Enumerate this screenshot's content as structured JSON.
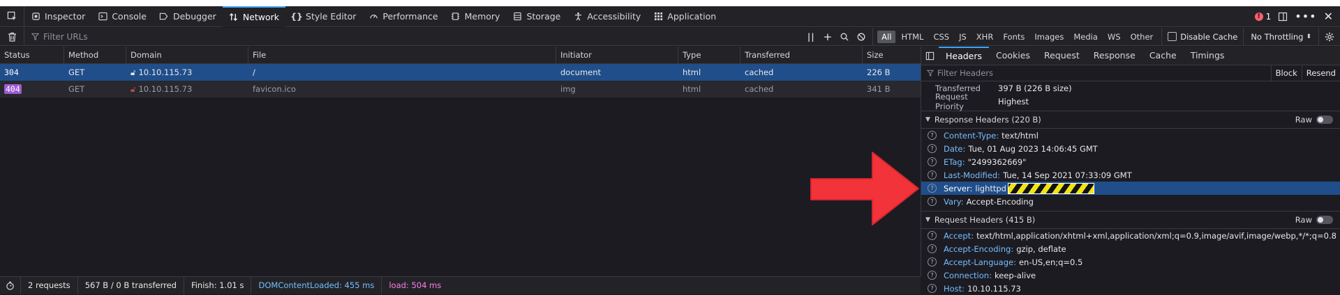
{
  "toolbar": {
    "tabs": [
      {
        "label": "Inspector",
        "icon": "inspector-icon"
      },
      {
        "label": "Console",
        "icon": "console-icon"
      },
      {
        "label": "Debugger",
        "icon": "debugger-icon"
      },
      {
        "label": "Network",
        "icon": "network-icon",
        "active": true
      },
      {
        "label": "Style Editor",
        "icon": "style-editor-icon"
      },
      {
        "label": "Performance",
        "icon": "performance-icon"
      },
      {
        "label": "Memory",
        "icon": "memory-icon"
      },
      {
        "label": "Storage",
        "icon": "storage-icon"
      },
      {
        "label": "Accessibility",
        "icon": "accessibility-icon"
      },
      {
        "label": "Application",
        "icon": "application-icon"
      }
    ],
    "error_count": "1"
  },
  "filterbar": {
    "placeholder": "Filter URLs",
    "types": [
      "All",
      "HTML",
      "CSS",
      "JS",
      "XHR",
      "Fonts",
      "Images",
      "Media",
      "WS",
      "Other"
    ],
    "active_type": "All",
    "disable_cache": "Disable Cache",
    "throttling": "No Throttling"
  },
  "table": {
    "columns": [
      "Status",
      "Method",
      "Domain",
      "File",
      "Initiator",
      "Type",
      "Transferred",
      "Size"
    ],
    "rows": [
      {
        "status": "304",
        "method": "GET",
        "domain": "10.10.115.73",
        "file": "/",
        "initiator": "document",
        "type": "html",
        "transferred": "cached",
        "size": "226 B"
      },
      {
        "status": "404",
        "method": "GET",
        "domain": "10.10.115.73",
        "file": "favicon.ico",
        "initiator": "img",
        "type": "html",
        "transferred": "cached",
        "size": "341 B"
      }
    ]
  },
  "footer": {
    "requests": "2 requests",
    "transferred": "567 B / 0 B transferred",
    "finish": "Finish: 1.01 s",
    "dcl": "DOMContentLoaded: 455 ms",
    "load": "load: 504 ms"
  },
  "details": {
    "tabs": [
      "Headers",
      "Cookies",
      "Request",
      "Response",
      "Cache",
      "Timings"
    ],
    "filter_placeholder": "Filter Headers",
    "block": "Block",
    "resend": "Resend",
    "summary": [
      {
        "key": "Transferred",
        "value": "397 B (226 B size)"
      },
      {
        "key": "Request Priority",
        "value": "Highest"
      }
    ],
    "response_title": "Response Headers (220 B)",
    "raw": "Raw",
    "response_headers": [
      {
        "name": "Content-Type:",
        "value": "text/html"
      },
      {
        "name": "Date:",
        "value": "Tue, 01 Aug 2023 14:06:45 GMT"
      },
      {
        "name": "ETag:",
        "value": "\"2499362669\""
      },
      {
        "name": "Last-Modified:",
        "value": "Tue, 14 Sep 2021 07:33:09 GMT"
      },
      {
        "name": "Server:",
        "value": "lighttpd"
      },
      {
        "name": "Vary:",
        "value": "Accept-Encoding"
      }
    ],
    "request_title": "Request Headers (415 B)",
    "request_headers": [
      {
        "name": "Accept:",
        "value": "text/html,application/xhtml+xml,application/xml;q=0.9,image/avif,image/webp,*/*;q=0.8"
      },
      {
        "name": "Accept-Encoding:",
        "value": "gzip, deflate"
      },
      {
        "name": "Accept-Language:",
        "value": "en-US,en;q=0.5"
      },
      {
        "name": "Connection:",
        "value": "keep-alive"
      },
      {
        "name": "Host:",
        "value": "10.10.115.73"
      }
    ]
  },
  "colors": {
    "accent": "#3ea3ff",
    "selected_row": "#204e8a",
    "arrow": "#f2333a"
  }
}
